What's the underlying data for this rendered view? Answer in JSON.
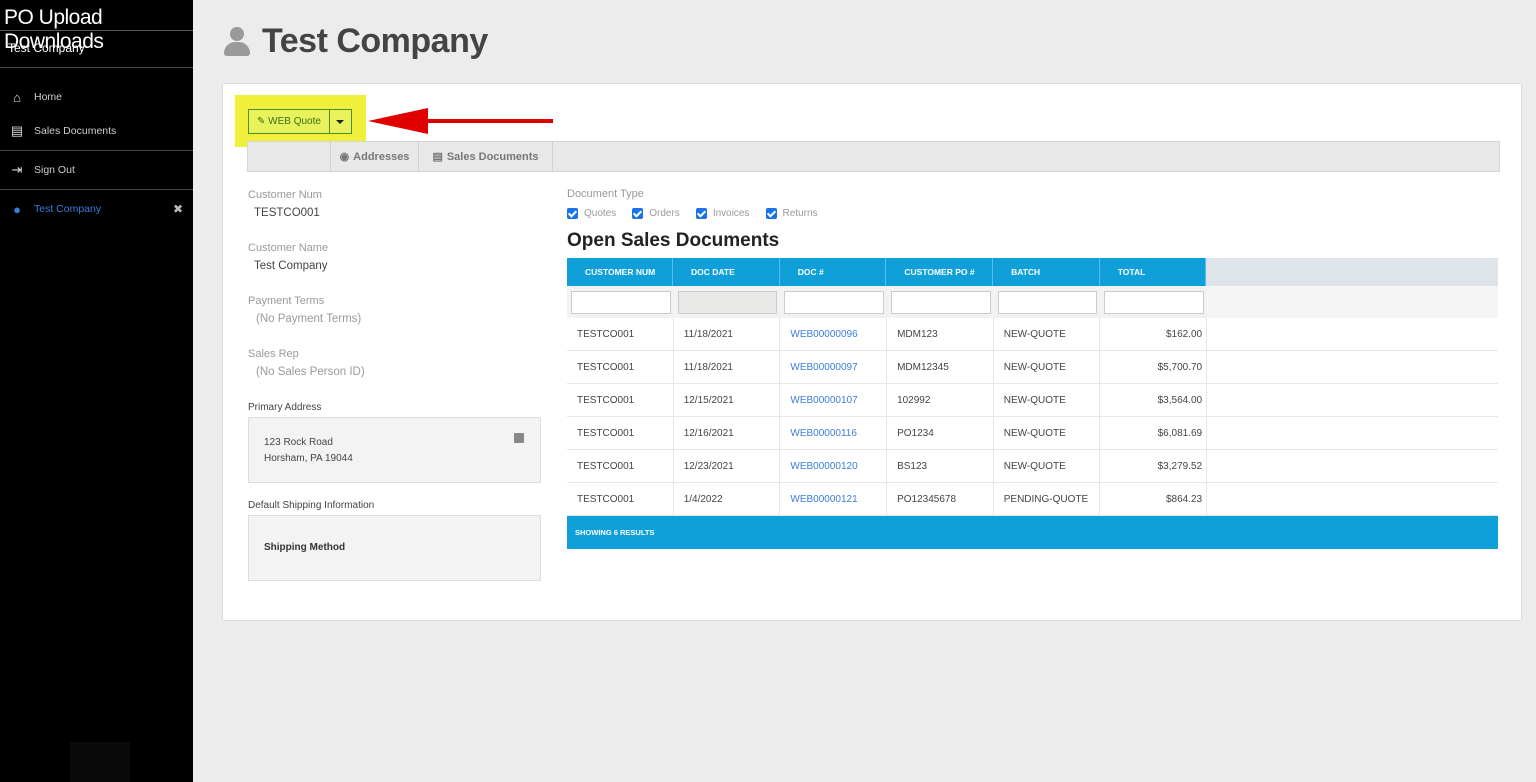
{
  "sidebar": {
    "brand": "PO Upload  Downloads",
    "company": "Test Company",
    "items": [
      {
        "label": "Home"
      },
      {
        "label": "Sales Documents"
      },
      {
        "label": "Sign Out"
      },
      {
        "label": "Test Company"
      }
    ],
    "close_glyph": "✖"
  },
  "header": {
    "title": "Test Company"
  },
  "toolbar": {
    "web_quote_label": "✎ WEB Quote"
  },
  "tabs": [
    {
      "label": "Addresses",
      "icon": "globe-icon"
    },
    {
      "label": "Sales Documents",
      "icon": "documents-icon"
    }
  ],
  "customer": {
    "num_label": "Customer Num",
    "num": "TESTCO001",
    "name_label": "Customer Name",
    "name": "Test Company",
    "terms_label": "Payment Terms",
    "terms": "(No Payment Terms)",
    "rep_label": "Sales Rep",
    "rep": "(No Sales Person ID)",
    "address_label": "Primary Address",
    "address_line1": "123 Rock Road",
    "address_line2": "Horsham, PA 19044",
    "shipping_label": "Default Shipping Information",
    "shipping_method": "Shipping Method"
  },
  "documents": {
    "type_label": "Document Type",
    "types": [
      "Quotes",
      "Orders",
      "Invoices",
      "Returns"
    ],
    "title": "Open Sales Documents",
    "columns": [
      "CUSTOMER NUM",
      "DOC DATE",
      "DOC #",
      "CUSTOMER PO #",
      "BATCH",
      "TOTAL"
    ],
    "rows": [
      [
        "TESTCO001",
        "11/18/2021",
        "WEB00000096",
        "MDM123",
        "NEW-QUOTE",
        "$162.00"
      ],
      [
        "TESTCO001",
        "11/18/2021",
        "WEB00000097",
        "MDM12345",
        "NEW-QUOTE",
        "$5,700.70"
      ],
      [
        "TESTCO001",
        "12/15/2021",
        "WEB00000107",
        "102992",
        "NEW-QUOTE",
        "$3,564.00"
      ],
      [
        "TESTCO001",
        "12/16/2021",
        "WEB00000116",
        "PO1234",
        "NEW-QUOTE",
        "$6,081.69"
      ],
      [
        "TESTCO001",
        "12/23/2021",
        "WEB00000120",
        "BS123",
        "NEW-QUOTE",
        "$3,279.52"
      ],
      [
        "TESTCO001",
        "1/4/2022",
        "WEB00000121",
        "PO12345678",
        "PENDING-QUOTE",
        "$864.23"
      ]
    ],
    "footer": "SHOWING 6 RESULTS"
  },
  "colors": {
    "accent": "#0fa0da",
    "highlight": "#f0f03a",
    "arrow": "#e00000",
    "link": "#3b7ddd"
  }
}
